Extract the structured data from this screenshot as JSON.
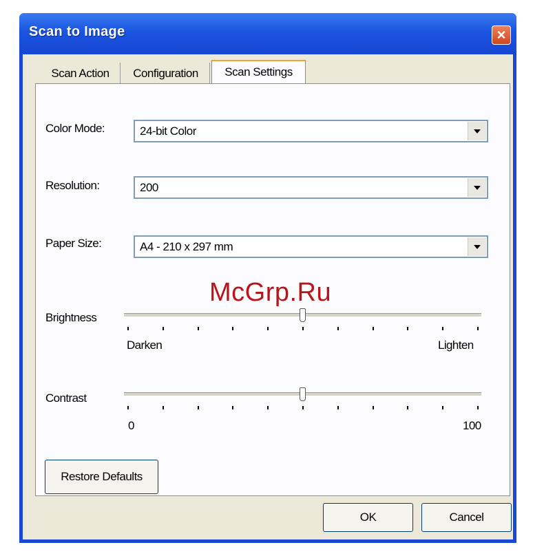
{
  "window": {
    "title": "Scan to Image"
  },
  "tabs": [
    {
      "label": "Scan Action",
      "active": false
    },
    {
      "label": "Configuration",
      "active": false
    },
    {
      "label": "Scan Settings",
      "active": true
    }
  ],
  "settings": {
    "color_mode": {
      "label": "Color Mode:",
      "value": "24-bit Color"
    },
    "resolution": {
      "label": "Resolution:",
      "value": "200"
    },
    "paper_size": {
      "label": "Paper Size:",
      "value": "A4 - 210 x 297 mm"
    },
    "brightness": {
      "label": "Brightness",
      "min_label": "Darken",
      "max_label": "Lighten",
      "level": 0.5
    },
    "contrast": {
      "label": "Contrast",
      "min_label": "0",
      "max_label": "100",
      "level": 0.5
    }
  },
  "buttons": {
    "restore_defaults": "Restore Defaults",
    "ok": "OK",
    "cancel": "Cancel"
  },
  "watermark": "McGrp.Ru",
  "icons": {
    "close": "close-icon",
    "dropdown": "chevron-down-icon"
  }
}
